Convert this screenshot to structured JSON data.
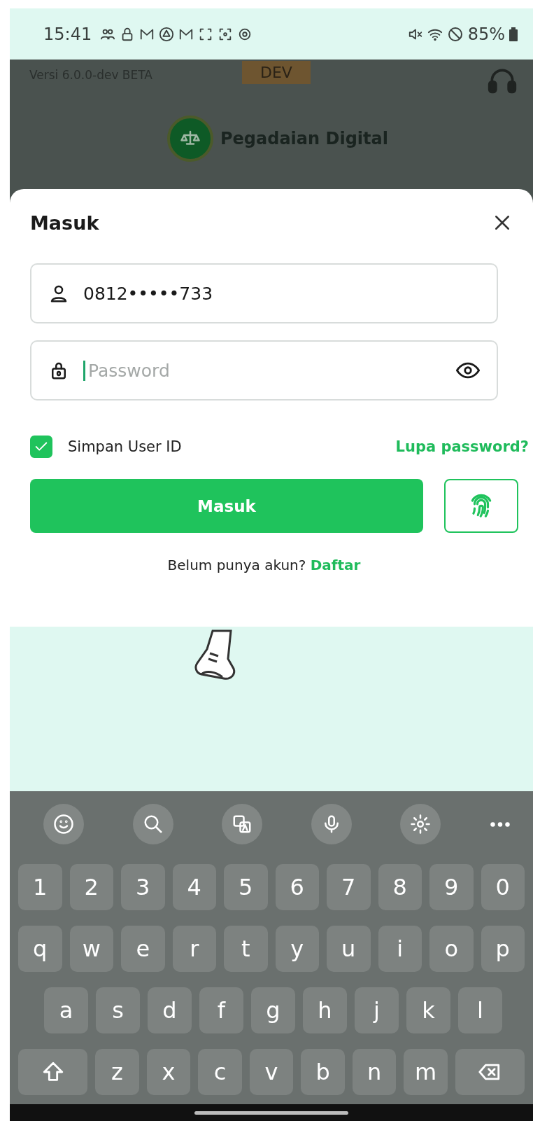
{
  "status_bar": {
    "time": "15:41",
    "battery": "85%"
  },
  "header": {
    "version": "Versi 6.0.0-dev BETA",
    "env_badge": "DEV",
    "app_name": "Pegadaian Digital"
  },
  "login_sheet": {
    "title": "Masuk",
    "phone_field": {
      "value": "0812•••••733"
    },
    "password_field": {
      "placeholder": "Password",
      "focused": true
    },
    "remember": {
      "label": "Simpan User ID",
      "checked": true
    },
    "forgot_link": "Lupa password?",
    "submit_button": "Masuk",
    "signup": {
      "prompt": "Belum punya akun?",
      "link": "Daftar"
    }
  },
  "keyboard": {
    "rows": [
      [
        "1",
        "2",
        "3",
        "4",
        "5",
        "6",
        "7",
        "8",
        "9",
        "0"
      ],
      [
        "q",
        "w",
        "e",
        "r",
        "t",
        "y",
        "u",
        "i",
        "o",
        "p"
      ],
      [
        "a",
        "s",
        "d",
        "f",
        "g",
        "h",
        "j",
        "k",
        "l"
      ],
      [
        "z",
        "x",
        "c",
        "v",
        "b",
        "n",
        "m"
      ]
    ]
  }
}
